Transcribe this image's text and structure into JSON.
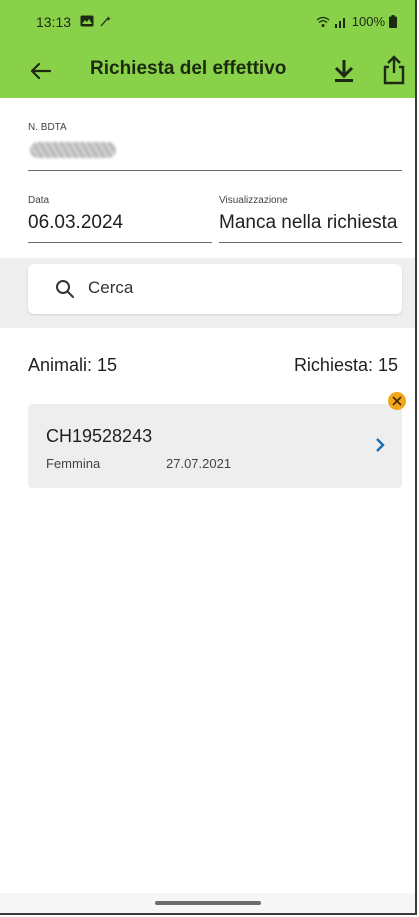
{
  "status_bar": {
    "time": "13:13",
    "battery": "100%"
  },
  "app_bar": {
    "title": "Richiesta del effettivo"
  },
  "form": {
    "bdta_label": "N. BDTA",
    "date_label": "Data",
    "date_value": "06.03.2024",
    "view_label": "Visualizzazione",
    "view_value": "Manca nella richiesta"
  },
  "search": {
    "placeholder": "Cerca"
  },
  "summary": {
    "animals": "Animali: 15",
    "requests": "Richiesta: 15"
  },
  "items": [
    {
      "id": "CH19528243",
      "sex": "Femmina",
      "date": "27.07.2021"
    }
  ],
  "colors": {
    "app_bar": "#8ad14a",
    "badge": "#f2a71b",
    "chevron": "#1a6fb5"
  }
}
